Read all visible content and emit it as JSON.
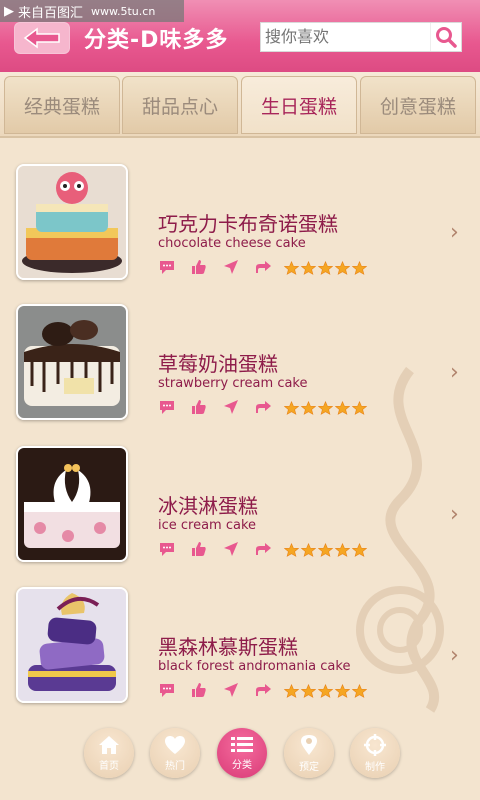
{
  "watermark": {
    "text": "来自百图汇",
    "url": "www.5tu.cn"
  },
  "header": {
    "title": "分类-D味多多",
    "search_placeholder": "搜你喜欢"
  },
  "tabs": [
    {
      "label": "经典蛋糕"
    },
    {
      "label": "甜品点心"
    },
    {
      "label": "生日蛋糕",
      "active": true
    },
    {
      "label": "创意蛋糕"
    }
  ],
  "items": [
    {
      "name_cn": "巧克力卡布奇诺蛋糕",
      "name_en": "chocolate cheese cake",
      "rating": 5
    },
    {
      "name_cn": "草莓奶油蛋糕",
      "name_en": "strawberry cream cake",
      "rating": 5
    },
    {
      "name_cn": "冰淇淋蛋糕",
      "name_en": "ice cream cake",
      "rating": 5
    },
    {
      "name_cn": "黑森林慕斯蛋糕",
      "name_en": "black forest andromania cake",
      "rating": 5
    }
  ],
  "bottom_nav": [
    {
      "label": "首页",
      "icon": "home-icon"
    },
    {
      "label": "热门",
      "icon": "heart-icon"
    },
    {
      "label": "分类",
      "icon": "list-icon",
      "active": true
    },
    {
      "label": "预定",
      "icon": "location-pin-icon"
    },
    {
      "label": "制作",
      "icon": "target-icon"
    }
  ],
  "colors": {
    "header": "#e8588f",
    "accent": "#a8265a",
    "background": "#f3e4cf",
    "star": "#f5a623"
  }
}
